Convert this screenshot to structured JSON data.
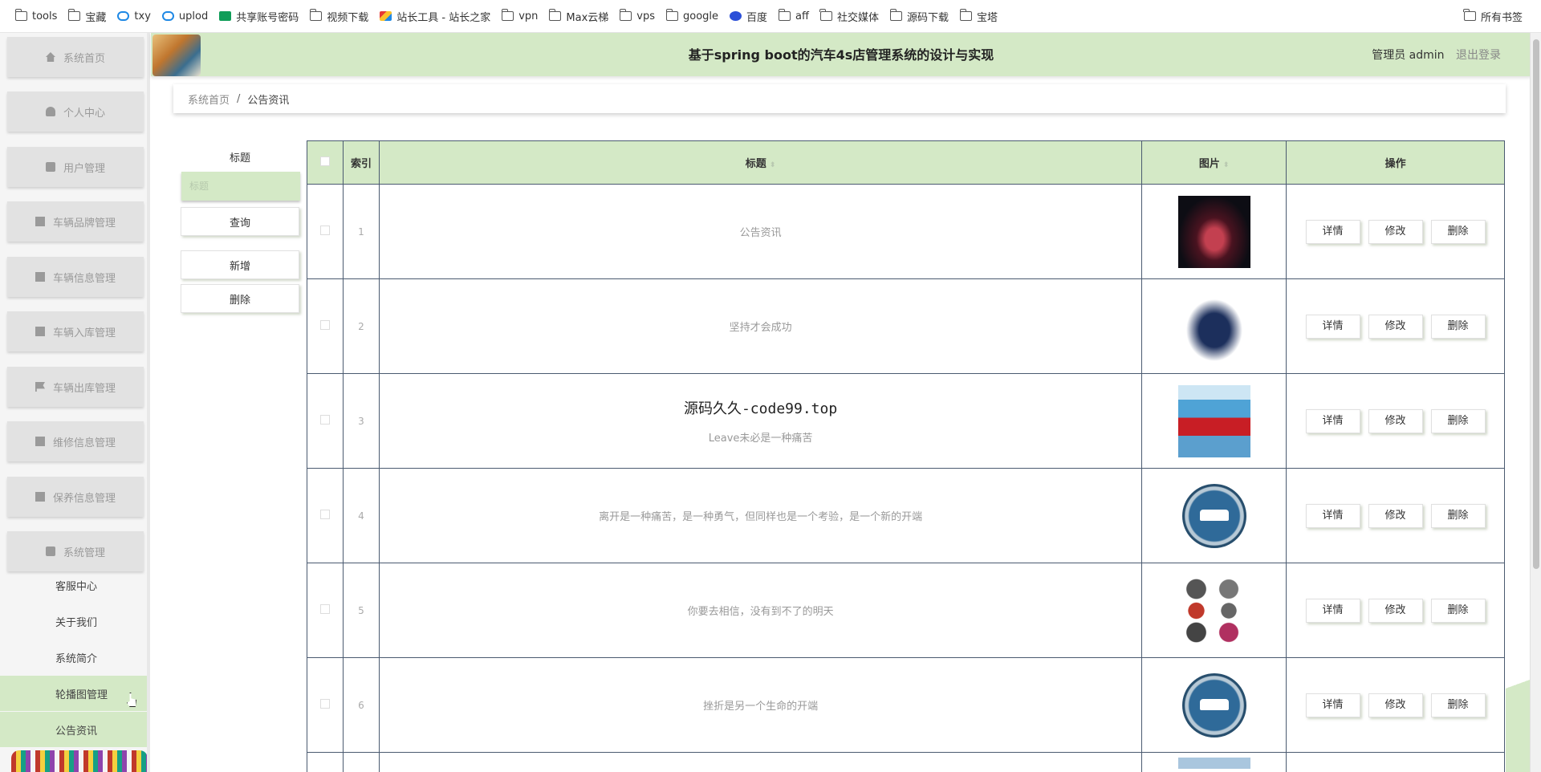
{
  "bookmarks": {
    "items": [
      {
        "label": "tools",
        "icon": "folder-icon"
      },
      {
        "label": "宝藏",
        "icon": "folder-icon"
      },
      {
        "label": "txy",
        "icon": "cloud-icon"
      },
      {
        "label": "uplod",
        "icon": "cloud-icon"
      },
      {
        "label": "共享账号密码",
        "icon": "sheet-icon"
      },
      {
        "label": "视频下载",
        "icon": "folder-icon"
      },
      {
        "label": "站长工具 - 站长之家",
        "icon": "site-icon"
      },
      {
        "label": "vpn",
        "icon": "folder-icon"
      },
      {
        "label": "Max云梯",
        "icon": "folder-icon"
      },
      {
        "label": "vps",
        "icon": "folder-icon"
      },
      {
        "label": "google",
        "icon": "folder-icon"
      },
      {
        "label": "百度",
        "icon": "baidu-icon"
      },
      {
        "label": "aff",
        "icon": "folder-icon"
      },
      {
        "label": "社交媒体",
        "icon": "folder-icon"
      },
      {
        "label": "源码下载",
        "icon": "folder-icon"
      },
      {
        "label": "宝塔",
        "icon": "folder-icon"
      }
    ],
    "all_bookmarks": "所有书签"
  },
  "sidebar": {
    "menu": [
      {
        "label": "系统首页",
        "icon": "home-icon"
      },
      {
        "label": "个人中心",
        "icon": "user-icon"
      },
      {
        "label": "用户管理",
        "icon": "clipboard-icon"
      },
      {
        "label": "车辆品牌管理",
        "icon": "grid-icon"
      },
      {
        "label": "车辆信息管理",
        "icon": "grid-icon"
      },
      {
        "label": "车辆入库管理",
        "icon": "list-icon"
      },
      {
        "label": "车辆出库管理",
        "icon": "flag-icon"
      },
      {
        "label": "维修信息管理",
        "icon": "grid-icon"
      },
      {
        "label": "保养信息管理",
        "icon": "list-icon"
      },
      {
        "label": "系统管理",
        "icon": "chart-icon"
      }
    ],
    "submenu": [
      "客服中心",
      "关于我们",
      "系统简介",
      "轮播图管理",
      "公告资讯"
    ],
    "active_sub": "轮播图管理"
  },
  "header": {
    "title": "基于spring boot的汽车4s店管理系统的设计与实现",
    "user": "管理员 admin",
    "logout": "退出登录"
  },
  "breadcrumb": {
    "home": "系统首页",
    "sep": "/",
    "current": "公告资讯"
  },
  "search": {
    "label": "标题",
    "placeholder": "标题",
    "query_button": "查询",
    "add_button": "新增",
    "delete_button": "删除"
  },
  "table": {
    "headers": {
      "index": "索引",
      "title": "标题",
      "image": "图片",
      "ops": "操作"
    },
    "ops": {
      "detail": "详情",
      "edit": "修改",
      "delete": "删除"
    },
    "watermark": "源码久久-code99.top",
    "rows": [
      {
        "index": "1",
        "title": "公告资讯",
        "image": "dark-sports-car-image"
      },
      {
        "index": "2",
        "title": "坚持才会成功",
        "image": "toy-car-image"
      },
      {
        "index": "3",
        "title": "Leave未必是一种痛苦",
        "image": "car-poster-image"
      },
      {
        "index": "4",
        "title": "离开是一种痛苦，是一种勇气，但同样也是一个考验，是一个新的开端",
        "image": "car-icon-image"
      },
      {
        "index": "5",
        "title": "你要去相信，没有到不了的明天",
        "image": "car-collection-image"
      },
      {
        "index": "6",
        "title": "挫折是另一个生命的开端",
        "image": "car-icon-image"
      }
    ]
  },
  "colors": {
    "accent": "#d4e9c6",
    "border": "#4a5a70",
    "sidebar_bg": "#e2e2e2"
  }
}
